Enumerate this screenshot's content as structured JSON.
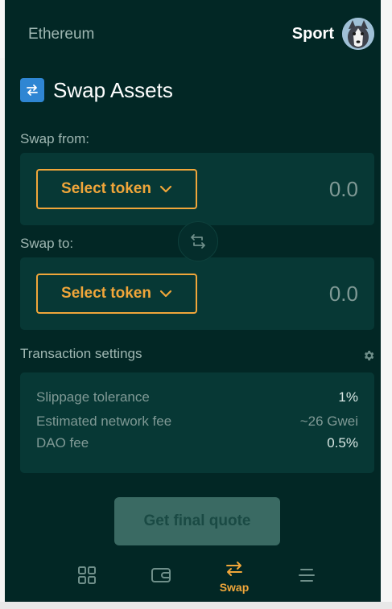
{
  "header": {
    "network": "Ethereum",
    "account_name": "Sport"
  },
  "title": "Swap Assets",
  "swap_from": {
    "label": "Swap from:",
    "token_button": "Select token",
    "amount": "0.0"
  },
  "swap_to": {
    "label": "Swap to:",
    "token_button": "Select token",
    "amount": "0.0"
  },
  "settings": {
    "label": "Transaction settings",
    "rows": [
      {
        "key": "Slippage tolerance",
        "value": "1%"
      },
      {
        "key": "Estimated network fee",
        "value": "~26 Gwei"
      },
      {
        "key": "DAO fee",
        "value": "0.5%"
      }
    ]
  },
  "quote_button": "Get final quote",
  "nav": {
    "items": [
      {
        "icon": "grid-icon",
        "label": ""
      },
      {
        "icon": "wallet-icon",
        "label": ""
      },
      {
        "icon": "swap-icon",
        "label": "Swap"
      },
      {
        "icon": "menu-icon",
        "label": ""
      }
    ],
    "active_index": 2
  },
  "colors": {
    "background": "#022725",
    "panel": "#073835",
    "accent": "#f0a63a",
    "title_icon": "#2f86d3",
    "disabled_button": "#3a6a63"
  }
}
